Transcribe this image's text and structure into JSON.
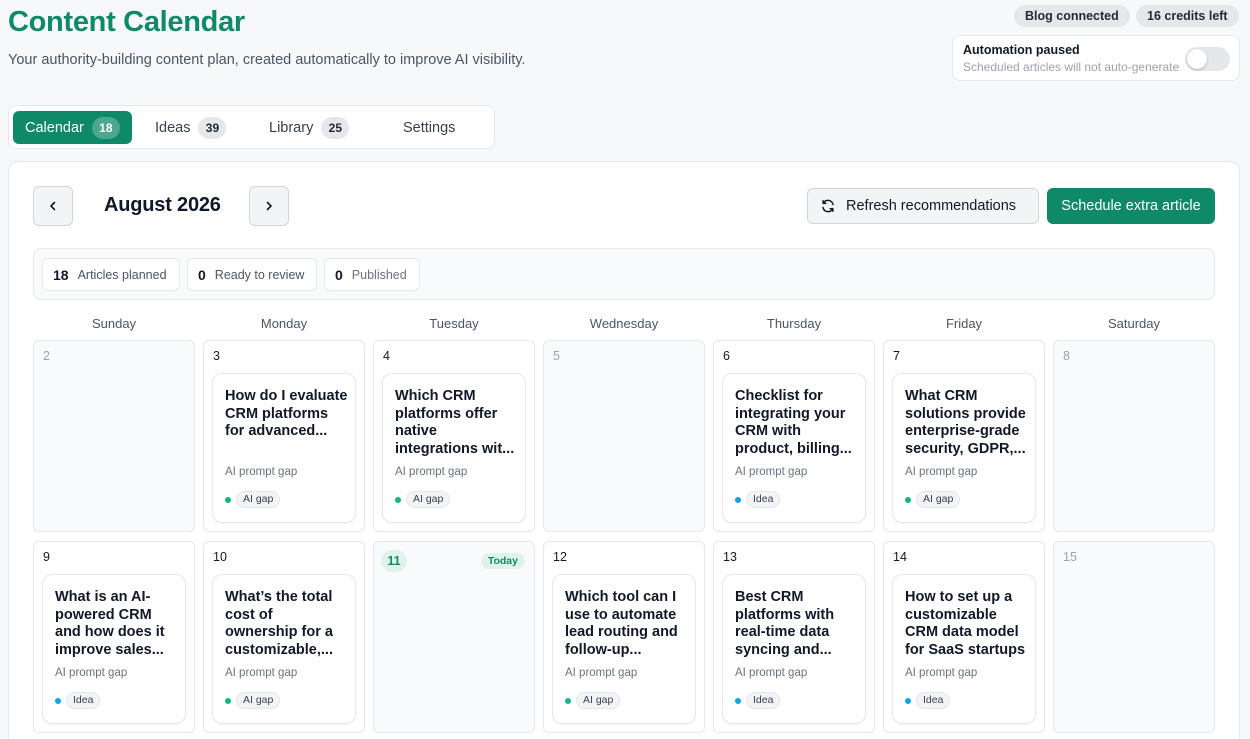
{
  "header": {
    "title": "Content Calendar",
    "subtitle": "Your authority-building content plan, created automatically to improve AI visibility.",
    "blog_status": "Blog connected",
    "credits": "16 credits left"
  },
  "automation": {
    "title": "Automation paused",
    "subtitle": "Scheduled articles will not auto-generate",
    "enabled": false
  },
  "tabs": [
    {
      "label": "Calendar",
      "count": "18",
      "active": true
    },
    {
      "label": "Ideas",
      "count": "39"
    },
    {
      "label": "Library",
      "count": "25"
    },
    {
      "label": "Settings"
    }
  ],
  "calendar": {
    "month": "August 2026",
    "refresh_label": "Refresh recommendations",
    "schedule_label": "Schedule extra article",
    "stats": [
      {
        "value": "18",
        "label": "Articles planned"
      },
      {
        "value": "0",
        "label": "Ready to review"
      },
      {
        "value": "0",
        "label": "Published"
      }
    ],
    "weekdays": [
      "Sunday",
      "Monday",
      "Tuesday",
      "Wednesday",
      "Thursday",
      "Friday",
      "Saturday"
    ],
    "today_label": "Today",
    "weeks": [
      [
        {
          "day": "2",
          "empty": true
        },
        {
          "day": "3",
          "article": {
            "title": "How do I evaluate CRM platforms for advanced...",
            "source": "AI prompt gap",
            "tag": "AI gap",
            "tag_color": "#10b981"
          }
        },
        {
          "day": "4",
          "article": {
            "title": "Which CRM platforms offer native integrations wit...",
            "source": "AI prompt gap",
            "tag": "AI gap",
            "tag_color": "#10b981"
          }
        },
        {
          "day": "5",
          "empty": true
        },
        {
          "day": "6",
          "article": {
            "title": "Checklist for integrating your CRM with product, billing...",
            "source": "AI prompt gap",
            "tag": "Idea",
            "tag_color": "#0ea5e9"
          }
        },
        {
          "day": "7",
          "article": {
            "title": "What CRM solutions provide enterprise-grade security, GDPR,...",
            "source": "AI prompt gap",
            "tag": "AI gap",
            "tag_color": "#10b981"
          }
        },
        {
          "day": "8",
          "empty": true
        }
      ],
      [
        {
          "day": "9",
          "article": {
            "title": "What is an AI-powered CRM and how does it improve sales...",
            "source": "AI prompt gap",
            "tag": "Idea",
            "tag_color": "#0ea5e9"
          }
        },
        {
          "day": "10",
          "article": {
            "title": "What’s the total cost of ownership for a customizable,...",
            "source": "AI prompt gap",
            "tag": "AI gap",
            "tag_color": "#10b981"
          }
        },
        {
          "day": "11",
          "today": true
        },
        {
          "day": "12",
          "article": {
            "title": "Which tool can I use to automate lead routing and follow-up...",
            "source": "AI prompt gap",
            "tag": "AI gap",
            "tag_color": "#10b981"
          }
        },
        {
          "day": "13",
          "article": {
            "title": "Best CRM platforms with real-time data syncing and...",
            "source": "AI prompt gap",
            "tag": "Idea",
            "tag_color": "#0ea5e9"
          }
        },
        {
          "day": "14",
          "article": {
            "title": "How to set up a customizable CRM data model for SaaS startups",
            "source": "AI prompt gap",
            "tag": "Idea",
            "tag_color": "#0ea5e9"
          }
        },
        {
          "day": "15",
          "empty": true
        }
      ]
    ]
  }
}
